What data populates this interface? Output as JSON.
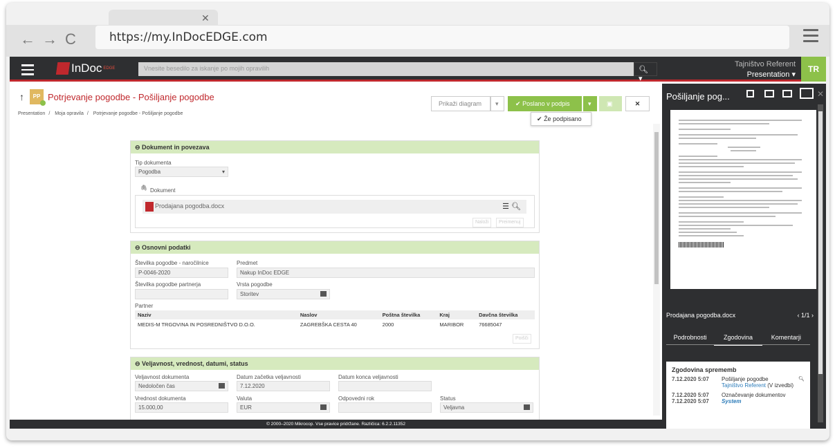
{
  "browser": {
    "url": "https://my.InDocEDGE.com"
  },
  "app": {
    "logo_text": "InDoc",
    "logo_sup": "EDGE",
    "search_placeholder": "Vnesite besedilo za iskanje po mojih opravilih",
    "user_role": "Tajništvo Referent",
    "user_company": "Presentation ▾",
    "avatar": "TR",
    "page_title": "Potrjevanje pogodbe - Pošiljanje pogodbe",
    "pp_badge": "PP",
    "breadcrumb": [
      "Presentation",
      "Moja opravila",
      "Potrjevanje pogodbe - Pošiljanje pogodbe"
    ],
    "buttons": {
      "show_diagram": "Prikaži diagram",
      "send": "Poslano v podpis",
      "close_glyph": "✕"
    },
    "dropdown_item": "Že podpisano",
    "footer": "© 2000–2020 Mikrocop. Vse pravice pridržane.  Različica:  6.2.2.11352"
  },
  "sections": {
    "doc": {
      "title": "Dokument in povezava",
      "type_label": "Tip dokumenta",
      "type_value": "Pogodba",
      "doc_label": "Dokument",
      "file_name": "Prodajana pogodba.docx",
      "btn_load": "Naloži",
      "btn_rename": "Preimenuj"
    },
    "basic": {
      "title": "Osnovni podatki",
      "num_label": "Številka pogodbe - naročilnice",
      "num_value": "P-0046-2020",
      "subject_label": "Predmet",
      "subject_value": "Nakup InDoc EDGE",
      "partner_num_label": "Številka pogodbe partnerja",
      "partner_num_value": "",
      "kind_label": "Vrsta pogodbe",
      "kind_value": "Storitev",
      "partner_label": "Partner",
      "table_headers": [
        "Naziv",
        "Naslov",
        "Poštna številka",
        "Kraj",
        "Davčna številka"
      ],
      "table_row": [
        "MEDIS-M TRGOVINA IN POSREDNIŠTVO D.O.O.",
        "ZAGREBŠKA CESTA 40",
        "2000",
        "MARIBOR",
        "76685047"
      ],
      "btn_search": "Poišči"
    },
    "validity": {
      "title": "Veljavnost, vrednost, datumi, status",
      "validity_label": "Veljavnost dokumenta",
      "validity_value": "Nedoločen čas",
      "start_label": "Datum začetka veljavnosti",
      "start_value": "7.12.2020",
      "end_label": "Datum konca veljavnosti",
      "end_value": "",
      "value_label": "Vrednost dokumenta",
      "value_value": "15.000,00",
      "currency_label": "Valuta",
      "currency_value": "EUR",
      "response_label": "Odpovedni rok",
      "response_value": "",
      "status_label": "Status",
      "status_value": "Veljavna"
    }
  },
  "panel": {
    "title": "Pošiljanje pog...",
    "doc_name": "Prodajana pogodba.docx",
    "page_info": "‹  1/1  ›",
    "tabs": [
      "Podrobnosti",
      "Zgodovina",
      "Komentarji"
    ],
    "history_title": "Zgodovina sprememb",
    "history": [
      {
        "date": "7.12.2020 5:07",
        "text": "Pošiljanje pogodbe",
        "who": "Tajništvo Referent",
        "extra": "(V izvedbi)"
      },
      {
        "date": "7.12.2020 5:07",
        "text": "Označevanje dokumentov",
        "who": "",
        "extra": ""
      },
      {
        "date": "7.12.2020 5:07",
        "text": "",
        "who": "System",
        "extra": ""
      }
    ]
  }
}
